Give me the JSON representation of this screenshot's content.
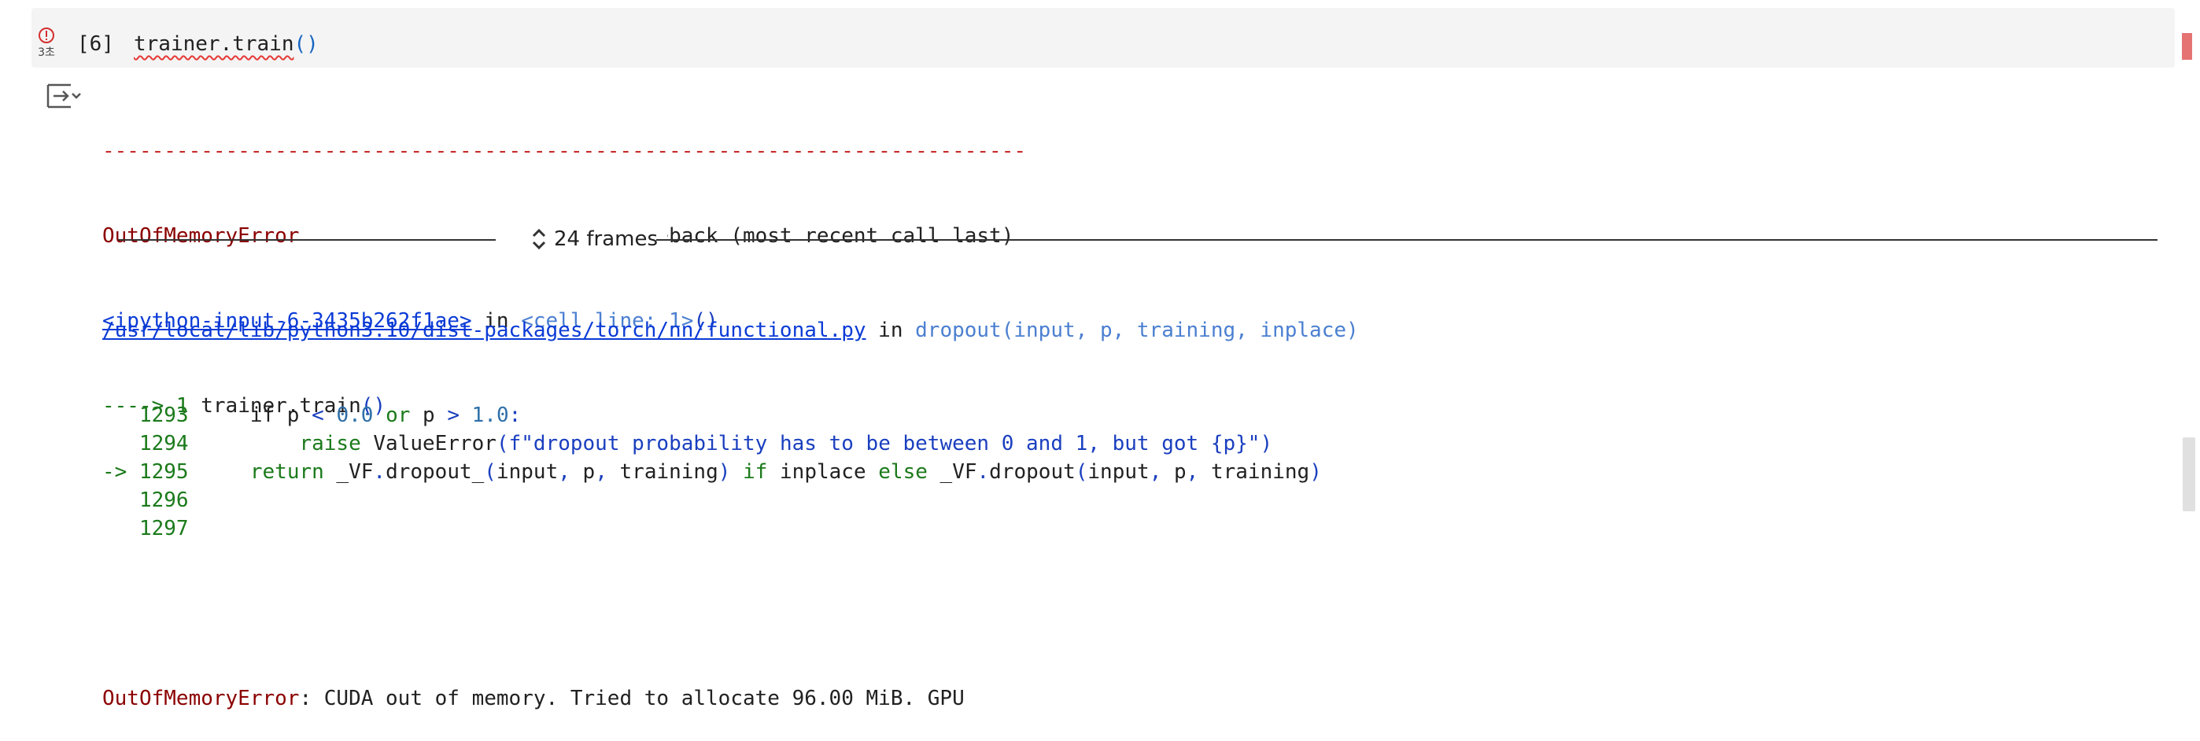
{
  "cell": {
    "exec_time": "3초",
    "exec_count": "[6]",
    "code_object": "trainer.train",
    "code_parens": "()"
  },
  "traceback": {
    "dashes": "---------------------------------------------------------------------------",
    "error_name": "OutOfMemoryError",
    "header_gap": "                         ",
    "header_right": "Traceback (most recent call last)",
    "frame1_link": "<ipython-input-6-3435b262f1ae>",
    "in_word": " in ",
    "frame1_location": "<cell line: 1>",
    "frame1_parens": "()",
    "arrow_line_prefix": "----> 1 ",
    "arrow_line_code": "trainer.train",
    "arrow_line_parens": "()",
    "frames_label": "24 frames",
    "frame2_link": "/usr/local/lib/python3.10/dist-packages/torch/nn/functional.py",
    "frame2_func": "dropout(input, p, training, inplace)",
    "lines": [
      {
        "prefix": "   1293",
        "code_parts": [
          {
            "t": "     if p ",
            "c": ""
          },
          {
            "t": "<",
            "c": "blue"
          },
          {
            "t": " ",
            "c": ""
          },
          {
            "t": "0.0",
            "c": "num"
          },
          {
            "t": " ",
            "c": ""
          },
          {
            "t": "or",
            "c": "kw"
          },
          {
            "t": " p ",
            "c": ""
          },
          {
            "t": ">",
            "c": "blue"
          },
          {
            "t": " ",
            "c": ""
          },
          {
            "t": "1.0",
            "c": "num"
          },
          {
            "t": ":",
            "c": "blue"
          }
        ]
      },
      {
        "prefix": "   1294",
        "code_parts": [
          {
            "t": "         ",
            "c": ""
          },
          {
            "t": "raise",
            "c": "kw"
          },
          {
            "t": " ValueError",
            "c": ""
          },
          {
            "t": "(f\"dropout probability has to be between 0 and 1, but got {p}\")",
            "c": "str"
          }
        ]
      },
      {
        "prefix": "-> 1295",
        "code_parts": [
          {
            "t": "     ",
            "c": ""
          },
          {
            "t": "return",
            "c": "kw"
          },
          {
            "t": " _VF",
            "c": ""
          },
          {
            "t": ".",
            "c": "blue"
          },
          {
            "t": "dropout_",
            "c": ""
          },
          {
            "t": "(",
            "c": "blue"
          },
          {
            "t": "input",
            "c": ""
          },
          {
            "t": ",",
            "c": "blue"
          },
          {
            "t": " p",
            "c": ""
          },
          {
            "t": ",",
            "c": "blue"
          },
          {
            "t": " training",
            "c": ""
          },
          {
            "t": ")",
            "c": "blue"
          },
          {
            "t": " ",
            "c": ""
          },
          {
            "t": "if",
            "c": "kw"
          },
          {
            "t": " inplace ",
            "c": ""
          },
          {
            "t": "else",
            "c": "kw"
          },
          {
            "t": " _VF",
            "c": ""
          },
          {
            "t": ".",
            "c": "blue"
          },
          {
            "t": "dropout",
            "c": ""
          },
          {
            "t": "(",
            "c": "blue"
          },
          {
            "t": "input",
            "c": ""
          },
          {
            "t": ",",
            "c": "blue"
          },
          {
            "t": " p",
            "c": ""
          },
          {
            "t": ",",
            "c": "blue"
          },
          {
            "t": " training",
            "c": ""
          },
          {
            "t": ")",
            "c": "blue"
          }
        ]
      },
      {
        "prefix": "   1296",
        "code_parts": []
      },
      {
        "prefix": "   1297",
        "code_parts": []
      }
    ],
    "final_error_name": "OutOfMemoryError",
    "final_message": ": CUDA out of memory. Tried to allocate 96.00 MiB. GPU"
  },
  "colors": {
    "error_red": "#8b0000",
    "link_blue": "#0b3bd6",
    "line_green": "#1b7a1b",
    "marker": "#e57373"
  }
}
